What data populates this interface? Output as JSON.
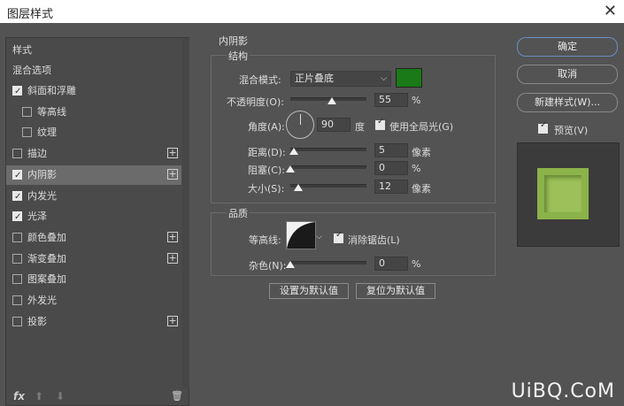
{
  "window": {
    "title": "图层样式",
    "close_glyph": "✕"
  },
  "left_panel": {
    "header": "样式",
    "blend_options": "混合选项",
    "items": [
      {
        "label": "斜面和浮雕",
        "checked": true,
        "plus": false,
        "indent": false
      },
      {
        "label": "等高线",
        "checked": false,
        "plus": false,
        "indent": true
      },
      {
        "label": "纹理",
        "checked": false,
        "plus": false,
        "indent": true
      },
      {
        "label": "描边",
        "checked": false,
        "plus": true,
        "indent": false
      },
      {
        "label": "内阴影",
        "checked": true,
        "plus": true,
        "indent": false,
        "selected": true
      },
      {
        "label": "内发光",
        "checked": true,
        "plus": false,
        "indent": false
      },
      {
        "label": "光泽",
        "checked": true,
        "plus": false,
        "indent": false
      },
      {
        "label": "颜色叠加",
        "checked": false,
        "plus": true,
        "indent": false
      },
      {
        "label": "渐变叠加",
        "checked": false,
        "plus": true,
        "indent": false
      },
      {
        "label": "图案叠加",
        "checked": false,
        "plus": false,
        "indent": false
      },
      {
        "label": "外发光",
        "checked": false,
        "plus": false,
        "indent": false
      },
      {
        "label": "投影",
        "checked": false,
        "plus": true,
        "indent": false
      }
    ],
    "footer": {
      "fx": "fx",
      "up": "⬆",
      "down": "⬇",
      "trash": "🗑"
    }
  },
  "inner_shadow": {
    "title": "内阴影",
    "structure": {
      "title": "结构",
      "blend_mode_label": "混合模式:",
      "blend_mode_value": "正片叠底",
      "color": "#1a7a17",
      "opacity_label": "不透明度(O):",
      "opacity_value": "55",
      "opacity_unit": "%",
      "angle_label": "角度(A):",
      "angle_value": "90",
      "angle_unit": "度",
      "global_light_label": "使用全局光(G)",
      "global_light_checked": true,
      "distance_label": "距离(D):",
      "distance_value": "5",
      "distance_unit": "像素",
      "choke_label": "阻塞(C):",
      "choke_value": "0",
      "choke_unit": "%",
      "size_label": "大小(S):",
      "size_value": "12",
      "size_unit": "像素"
    },
    "quality": {
      "title": "品质",
      "contour_label": "等高线:",
      "antialias_label": "消除锯齿(L)",
      "antialias_checked": true,
      "noise_label": "杂色(N):",
      "noise_value": "0",
      "noise_unit": "%"
    },
    "set_default": "设置为默认值",
    "reset_default": "复位为默认值"
  },
  "right_panel": {
    "ok": "确定",
    "cancel": "取消",
    "new_style": "新建样式(W)...",
    "preview_label": "预览(V)",
    "preview_checked": true
  },
  "watermark": "UiBQ.CoM"
}
